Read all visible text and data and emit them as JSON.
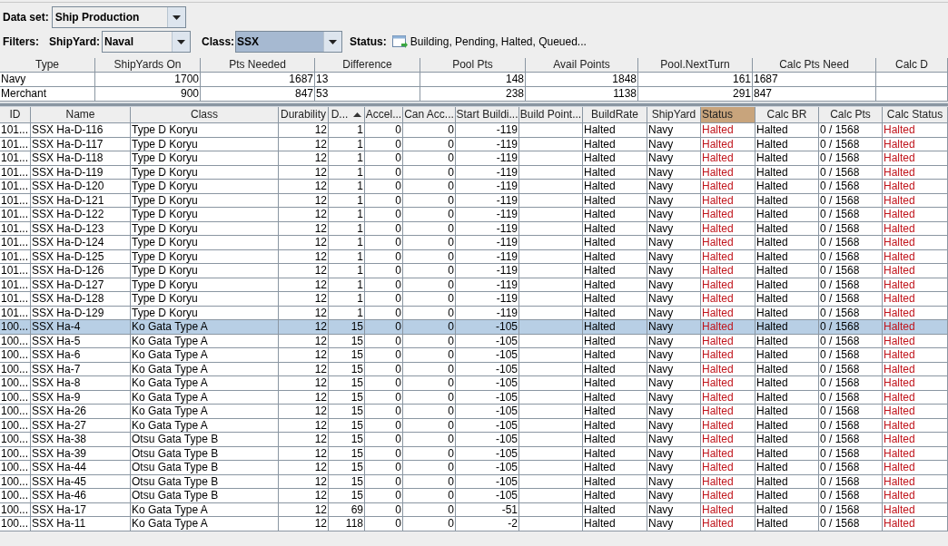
{
  "dataset": {
    "label": "Data set:",
    "value": "Ship Production"
  },
  "filters": {
    "label": "Filters:",
    "shipyard": {
      "label": "ShipYard:",
      "value": "Naval",
      "selected": false
    },
    "class": {
      "label": "Class:",
      "value": "SSX",
      "selected": true
    },
    "status": {
      "label": "Status:",
      "value": "Building, Pending, Halted, Queued..."
    }
  },
  "summary_table": {
    "columns": [
      {
        "label": "Type",
        "kind": "text"
      },
      {
        "label": "ShipYards On",
        "kind": "number"
      },
      {
        "label": "Pts Needed",
        "kind": "number"
      },
      {
        "label": "Difference",
        "kind": "text"
      },
      {
        "label": "Pool Pts",
        "kind": "number"
      },
      {
        "label": "Avail Points",
        "kind": "number"
      },
      {
        "label": "Pool.NextTurn",
        "kind": "number"
      },
      {
        "label": "Calc Pts Need",
        "kind": "text"
      },
      {
        "label": "Calc D",
        "kind": "text"
      }
    ],
    "rows": [
      [
        "Navy",
        "1700",
        "1687",
        "13",
        "148",
        "1848",
        "161",
        "1687",
        null
      ],
      [
        "Merchant",
        "900",
        "847",
        "53",
        "238",
        "1138",
        "291",
        "847",
        null
      ]
    ]
  },
  "table": {
    "columns": [
      {
        "label": "ID",
        "kind": "text",
        "sorted": false,
        "highlighted": false
      },
      {
        "label": "Name",
        "kind": "text",
        "sorted": false,
        "highlighted": false
      },
      {
        "label": "Class",
        "kind": "text",
        "sorted": false,
        "highlighted": false
      },
      {
        "label": "Durability",
        "kind": "number",
        "sorted": false,
        "highlighted": false
      },
      {
        "label": "D...",
        "kind": "number",
        "sorted": true,
        "highlighted": false
      },
      {
        "label": "Accel...",
        "kind": "number",
        "sorted": false,
        "highlighted": false
      },
      {
        "label": "Can Acc...",
        "kind": "number",
        "sorted": false,
        "highlighted": false
      },
      {
        "label": "Start Buildi...",
        "kind": "number",
        "sorted": false,
        "highlighted": false
      },
      {
        "label": "Build Point...",
        "kind": "text",
        "sorted": false,
        "highlighted": false
      },
      {
        "label": "BuildRate",
        "kind": "text",
        "sorted": false,
        "highlighted": false
      },
      {
        "label": "ShipYard",
        "kind": "text",
        "sorted": false,
        "highlighted": false
      },
      {
        "label": "Status",
        "kind": "status",
        "sorted": false,
        "highlighted": true
      },
      {
        "label": "Calc BR",
        "kind": "text",
        "sorted": false,
        "highlighted": false
      },
      {
        "label": "Calc Pts",
        "kind": "text",
        "sorted": false,
        "highlighted": false
      },
      {
        "label": "Calc Status",
        "kind": "status",
        "sorted": false,
        "highlighted": false
      }
    ],
    "rows": [
      {
        "selected": false,
        "cells": [
          "101...",
          "SSX Ha-D-116",
          "Type D Koryu",
          "12",
          "1",
          "0",
          "0",
          "-119",
          null,
          "Halted",
          "Navy",
          "Halted",
          "Halted",
          "0 / 1568",
          "Halted"
        ]
      },
      {
        "selected": false,
        "cells": [
          "101...",
          "SSX Ha-D-117",
          "Type D Koryu",
          "12",
          "1",
          "0",
          "0",
          "-119",
          null,
          "Halted",
          "Navy",
          "Halted",
          "Halted",
          "0 / 1568",
          "Halted"
        ]
      },
      {
        "selected": false,
        "cells": [
          "101...",
          "SSX Ha-D-118",
          "Type D Koryu",
          "12",
          "1",
          "0",
          "0",
          "-119",
          null,
          "Halted",
          "Navy",
          "Halted",
          "Halted",
          "0 / 1568",
          "Halted"
        ]
      },
      {
        "selected": false,
        "cells": [
          "101...",
          "SSX Ha-D-119",
          "Type D Koryu",
          "12",
          "1",
          "0",
          "0",
          "-119",
          null,
          "Halted",
          "Navy",
          "Halted",
          "Halted",
          "0 / 1568",
          "Halted"
        ]
      },
      {
        "selected": false,
        "cells": [
          "101...",
          "SSX Ha-D-120",
          "Type D Koryu",
          "12",
          "1",
          "0",
          "0",
          "-119",
          null,
          "Halted",
          "Navy",
          "Halted",
          "Halted",
          "0 / 1568",
          "Halted"
        ]
      },
      {
        "selected": false,
        "cells": [
          "101...",
          "SSX Ha-D-121",
          "Type D Koryu",
          "12",
          "1",
          "0",
          "0",
          "-119",
          null,
          "Halted",
          "Navy",
          "Halted",
          "Halted",
          "0 / 1568",
          "Halted"
        ]
      },
      {
        "selected": false,
        "cells": [
          "101...",
          "SSX Ha-D-122",
          "Type D Koryu",
          "12",
          "1",
          "0",
          "0",
          "-119",
          null,
          "Halted",
          "Navy",
          "Halted",
          "Halted",
          "0 / 1568",
          "Halted"
        ]
      },
      {
        "selected": false,
        "cells": [
          "101...",
          "SSX Ha-D-123",
          "Type D Koryu",
          "12",
          "1",
          "0",
          "0",
          "-119",
          null,
          "Halted",
          "Navy",
          "Halted",
          "Halted",
          "0 / 1568",
          "Halted"
        ]
      },
      {
        "selected": false,
        "cells": [
          "101...",
          "SSX Ha-D-124",
          "Type D Koryu",
          "12",
          "1",
          "0",
          "0",
          "-119",
          null,
          "Halted",
          "Navy",
          "Halted",
          "Halted",
          "0 / 1568",
          "Halted"
        ]
      },
      {
        "selected": false,
        "cells": [
          "101...",
          "SSX Ha-D-125",
          "Type D Koryu",
          "12",
          "1",
          "0",
          "0",
          "-119",
          null,
          "Halted",
          "Navy",
          "Halted",
          "Halted",
          "0 / 1568",
          "Halted"
        ]
      },
      {
        "selected": false,
        "cells": [
          "101...",
          "SSX Ha-D-126",
          "Type D Koryu",
          "12",
          "1",
          "0",
          "0",
          "-119",
          null,
          "Halted",
          "Navy",
          "Halted",
          "Halted",
          "0 / 1568",
          "Halted"
        ]
      },
      {
        "selected": false,
        "cells": [
          "101...",
          "SSX Ha-D-127",
          "Type D Koryu",
          "12",
          "1",
          "0",
          "0",
          "-119",
          null,
          "Halted",
          "Navy",
          "Halted",
          "Halted",
          "0 / 1568",
          "Halted"
        ]
      },
      {
        "selected": false,
        "cells": [
          "101...",
          "SSX Ha-D-128",
          "Type D Koryu",
          "12",
          "1",
          "0",
          "0",
          "-119",
          null,
          "Halted",
          "Navy",
          "Halted",
          "Halted",
          "0 / 1568",
          "Halted"
        ]
      },
      {
        "selected": false,
        "cells": [
          "101...",
          "SSX Ha-D-129",
          "Type D Koryu",
          "12",
          "1",
          "0",
          "0",
          "-119",
          null,
          "Halted",
          "Navy",
          "Halted",
          "Halted",
          "0 / 1568",
          "Halted"
        ]
      },
      {
        "selected": true,
        "cells": [
          "100...",
          "SSX Ha-4",
          "Ko Gata Type A",
          "12",
          "15",
          "0",
          "0",
          "-105",
          null,
          "Halted",
          "Navy",
          "Halted",
          "Halted",
          "0 / 1568",
          "Halted"
        ]
      },
      {
        "selected": false,
        "cells": [
          "100...",
          "SSX Ha-5",
          "Ko Gata Type A",
          "12",
          "15",
          "0",
          "0",
          "-105",
          null,
          "Halted",
          "Navy",
          "Halted",
          "Halted",
          "0 / 1568",
          "Halted"
        ]
      },
      {
        "selected": false,
        "cells": [
          "100...",
          "SSX Ha-6",
          "Ko Gata Type A",
          "12",
          "15",
          "0",
          "0",
          "-105",
          null,
          "Halted",
          "Navy",
          "Halted",
          "Halted",
          "0 / 1568",
          "Halted"
        ]
      },
      {
        "selected": false,
        "cells": [
          "100...",
          "SSX Ha-7",
          "Ko Gata Type A",
          "12",
          "15",
          "0",
          "0",
          "-105",
          null,
          "Halted",
          "Navy",
          "Halted",
          "Halted",
          "0 / 1568",
          "Halted"
        ]
      },
      {
        "selected": false,
        "cells": [
          "100...",
          "SSX Ha-8",
          "Ko Gata Type A",
          "12",
          "15",
          "0",
          "0",
          "-105",
          null,
          "Halted",
          "Navy",
          "Halted",
          "Halted",
          "0 / 1568",
          "Halted"
        ]
      },
      {
        "selected": false,
        "cells": [
          "100...",
          "SSX Ha-9",
          "Ko Gata Type A",
          "12",
          "15",
          "0",
          "0",
          "-105",
          null,
          "Halted",
          "Navy",
          "Halted",
          "Halted",
          "0 / 1568",
          "Halted"
        ]
      },
      {
        "selected": false,
        "cells": [
          "100...",
          "SSX Ha-26",
          "Ko Gata Type A",
          "12",
          "15",
          "0",
          "0",
          "-105",
          null,
          "Halted",
          "Navy",
          "Halted",
          "Halted",
          "0 / 1568",
          "Halted"
        ]
      },
      {
        "selected": false,
        "cells": [
          "100...",
          "SSX Ha-27",
          "Ko Gata Type A",
          "12",
          "15",
          "0",
          "0",
          "-105",
          null,
          "Halted",
          "Navy",
          "Halted",
          "Halted",
          "0 / 1568",
          "Halted"
        ]
      },
      {
        "selected": false,
        "cells": [
          "100...",
          "SSX Ha-38",
          "Otsu Gata Type B",
          "12",
          "15",
          "0",
          "0",
          "-105",
          null,
          "Halted",
          "Navy",
          "Halted",
          "Halted",
          "0 / 1568",
          "Halted"
        ]
      },
      {
        "selected": false,
        "cells": [
          "100...",
          "SSX Ha-39",
          "Otsu Gata Type B",
          "12",
          "15",
          "0",
          "0",
          "-105",
          null,
          "Halted",
          "Navy",
          "Halted",
          "Halted",
          "0 / 1568",
          "Halted"
        ]
      },
      {
        "selected": false,
        "cells": [
          "100...",
          "SSX Ha-44",
          "Otsu Gata Type B",
          "12",
          "15",
          "0",
          "0",
          "-105",
          null,
          "Halted",
          "Navy",
          "Halted",
          "Halted",
          "0 / 1568",
          "Halted"
        ]
      },
      {
        "selected": false,
        "cells": [
          "100...",
          "SSX Ha-45",
          "Otsu Gata Type B",
          "12",
          "15",
          "0",
          "0",
          "-105",
          null,
          "Halted",
          "Navy",
          "Halted",
          "Halted",
          "0 / 1568",
          "Halted"
        ]
      },
      {
        "selected": false,
        "cells": [
          "100...",
          "SSX Ha-46",
          "Otsu Gata Type B",
          "12",
          "15",
          "0",
          "0",
          "-105",
          null,
          "Halted",
          "Navy",
          "Halted",
          "Halted",
          "0 / 1568",
          "Halted"
        ]
      },
      {
        "selected": false,
        "cells": [
          "100...",
          "SSX Ha-17",
          "Ko Gata Type A",
          "12",
          "69",
          "0",
          "0",
          "-51",
          null,
          "Halted",
          "Navy",
          "Halted",
          "Halted",
          "0 / 1568",
          "Halted"
        ]
      },
      {
        "selected": false,
        "cells": [
          "100...",
          "SSX Ha-11",
          "Ko Gata Type A",
          "12",
          "118",
          "0",
          "0",
          "-2",
          null,
          "Halted",
          "Navy",
          "Halted",
          "Halted",
          "0 / 1568",
          "Halted"
        ]
      }
    ]
  }
}
